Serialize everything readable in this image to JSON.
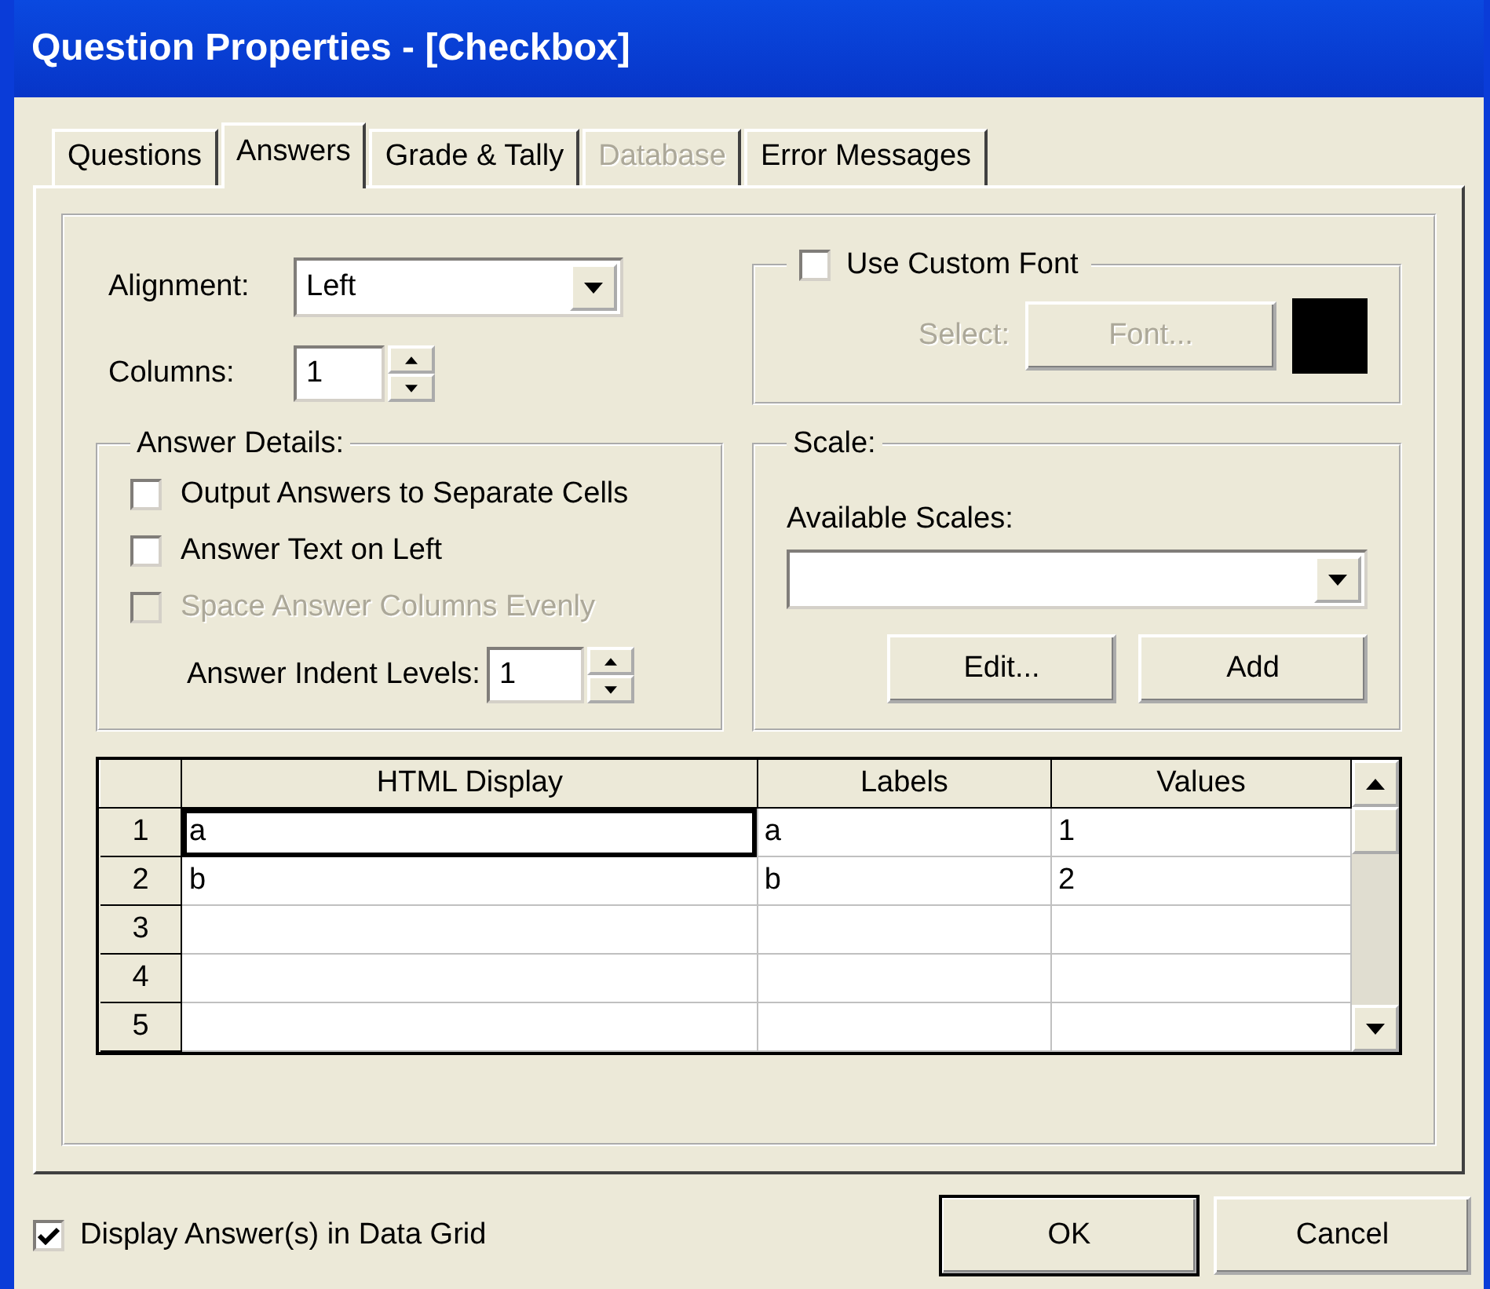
{
  "window": {
    "title": "Question Properties - [Checkbox]"
  },
  "tabs": [
    {
      "label": "Questions",
      "selected": false,
      "disabled": false
    },
    {
      "label": "Answers",
      "selected": true,
      "disabled": false
    },
    {
      "label": "Grade & Tally",
      "selected": false,
      "disabled": false
    },
    {
      "label": "Database",
      "selected": false,
      "disabled": true
    },
    {
      "label": "Error Messages",
      "selected": false,
      "disabled": false
    }
  ],
  "alignment": {
    "label": "Alignment:",
    "value": "Left"
  },
  "columns": {
    "label": "Columns:",
    "value": "1"
  },
  "custom_font": {
    "label": "Use Custom Font",
    "checked": false,
    "select_label": "Select:",
    "button": "Font...",
    "disabled": true
  },
  "answer_details": {
    "title": "Answer Details:",
    "options": [
      {
        "label": "Output Answers to Separate Cells",
        "checked": false,
        "disabled": false
      },
      {
        "label": "Answer Text on Left",
        "checked": false,
        "disabled": false
      },
      {
        "label": "Space Answer Columns Evenly",
        "checked": false,
        "disabled": true
      }
    ],
    "indent": {
      "label": "Answer Indent Levels:",
      "value": "1"
    }
  },
  "scale": {
    "title": "Scale:",
    "available_label": "Available Scales:",
    "buttons": [
      "Edit...",
      "Add"
    ]
  },
  "grid": {
    "columns": [
      "HTML Display",
      "Labels",
      "Values"
    ],
    "rows": [
      {
        "number": "1",
        "cells": [
          {
            "text": "a",
            "selected": true
          },
          {
            "text": "a",
            "selected": false
          },
          {
            "text": "1",
            "selected": false
          }
        ]
      },
      {
        "number": "2",
        "cells": [
          {
            "text": "b",
            "selected": false
          },
          {
            "text": "b",
            "selected": false
          },
          {
            "text": "2",
            "selected": false
          }
        ]
      },
      {
        "number": "3"
      },
      {
        "number": "4"
      },
      {
        "number": "5"
      }
    ]
  },
  "display_in_grid": {
    "label": "Display Answer(s) in Data Grid",
    "checked": true
  },
  "buttons": [
    {
      "label": "OK",
      "default": true
    },
    {
      "label": "Cancel",
      "default": false
    }
  ]
}
